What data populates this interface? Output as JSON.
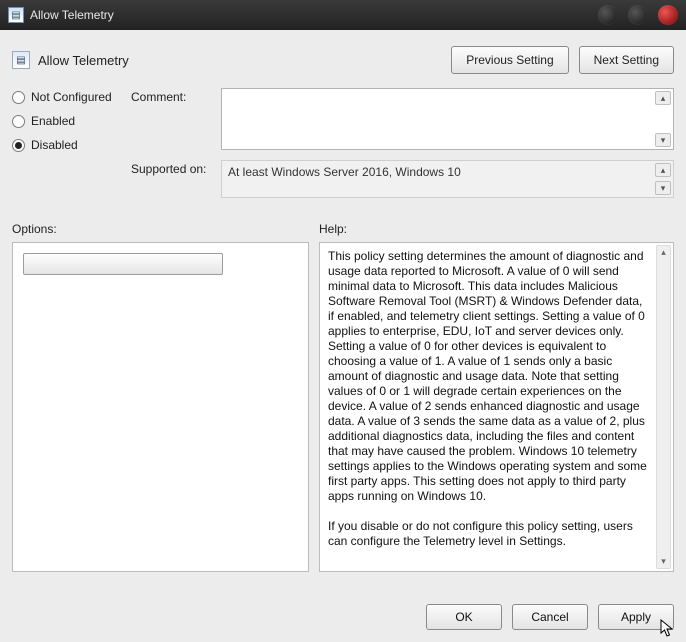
{
  "window": {
    "title": "Allow Telemetry"
  },
  "header": {
    "title": "Allow Telemetry",
    "prev_label": "Previous Setting",
    "next_label": "Next Setting"
  },
  "state": {
    "options": [
      {
        "label": "Not Configured",
        "checked": false
      },
      {
        "label": "Enabled",
        "checked": false
      },
      {
        "label": "Disabled",
        "checked": true
      }
    ]
  },
  "fields": {
    "comment_label": "Comment:",
    "comment_value": "",
    "supported_label": "Supported on:",
    "supported_value": "At least Windows Server 2016, Windows 10"
  },
  "sections": {
    "options_label": "Options:",
    "help_label": "Help:"
  },
  "help": {
    "body": "This policy setting determines the amount of diagnostic and usage data reported to Microsoft. A value of 0 will send minimal data to Microsoft. This data includes Malicious Software Removal Tool (MSRT) & Windows Defender data, if enabled, and telemetry client settings. Setting a value of 0 applies to enterprise, EDU, IoT and server devices only. Setting a value of 0 for other devices is equivalent to choosing a value of 1. A value of 1 sends only a basic amount of diagnostic and usage data. Note that setting values of 0 or 1 will degrade certain experiences on the device. A value of 2 sends enhanced diagnostic and usage data. A value of 3 sends the same data as a value of 2, plus additional diagnostics data, including the files and content that may have caused the problem. Windows 10 telemetry settings applies to the Windows operating system and some first party apps. This setting does not apply to third party apps running on Windows 10.\n\nIf you disable or do not configure this policy setting, users can configure the Telemetry level in Settings."
  },
  "footer": {
    "ok": "OK",
    "cancel": "Cancel",
    "apply": "Apply"
  },
  "icons": {
    "app": "▤",
    "up": "▴",
    "down": "▾"
  }
}
